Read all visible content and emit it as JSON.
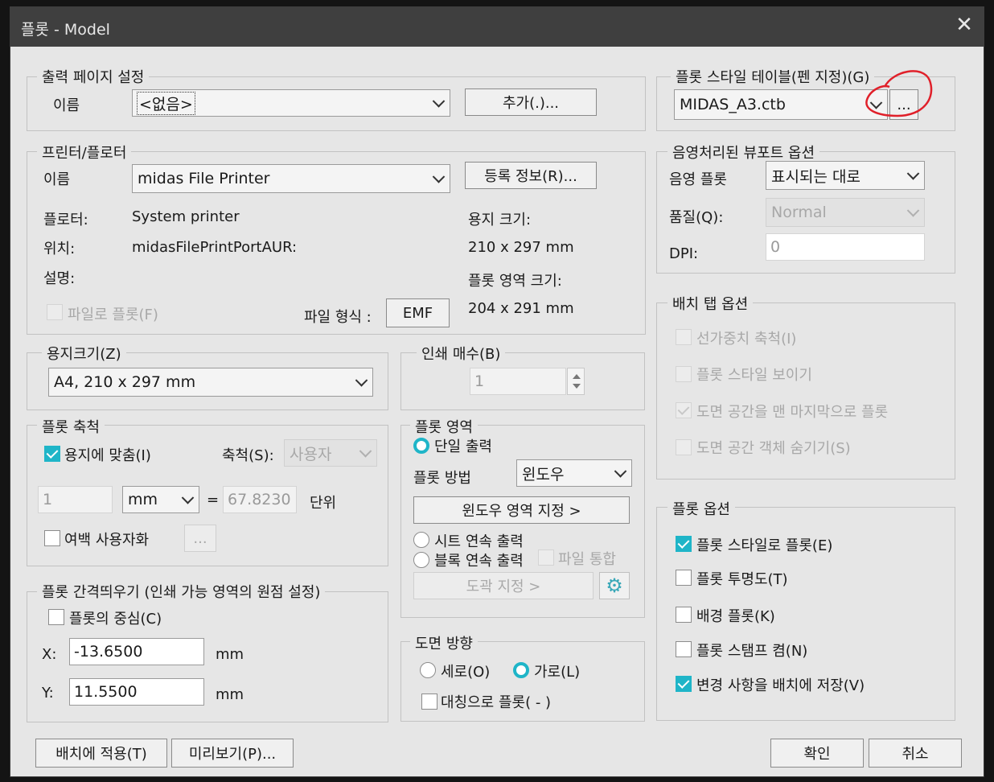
{
  "window": {
    "title": "플롯 - Model",
    "close_glyph": "✕"
  },
  "page_setup": {
    "legend": "출력 페이지 설정",
    "name_label": "이름",
    "name_value": "<없음>",
    "add_button": "추가(.)..."
  },
  "printer": {
    "legend": "프린터/플로터",
    "name_label": "이름",
    "name_value": "midas File Printer",
    "properties_button": "등록 정보(R)...",
    "plotter_label": "플로터:",
    "plotter_value": "System printer",
    "where_label": "위치:",
    "where_value": "midasFilePrintPortAUR:",
    "desc_label": "설명:",
    "plot_to_file": "파일로 플롯(F)",
    "file_format_label": "파일 형식 :",
    "file_format_button": "EMF",
    "paper_size_label": "용지 크기:",
    "paper_size_value": "210 x 297 mm",
    "plot_area_size_label": "플롯 영역 크기:",
    "plot_area_size_value": "204 x 291 mm"
  },
  "paper_size": {
    "legend": "용지크기(Z)",
    "value": "A4, 210 x 297 mm"
  },
  "copies": {
    "legend": "인쇄 매수(B)",
    "value": "1"
  },
  "plot_scale": {
    "legend": "플롯 축척",
    "fit_to_paper": "용지에 맞춤(I)",
    "scale_label": "축척(S):",
    "scale_value": "사용자",
    "value1": "1",
    "unit": "mm",
    "equals": "=",
    "value2": "67.8230",
    "unit_label": "단위",
    "scale_lineweights": "여백 사용자화",
    "ellipsis": "..."
  },
  "plot_offset": {
    "legend": "플롯 간격띄우기 (인쇄 가능 영역의 원점 설정)",
    "center": "플롯의 중심(C)",
    "x_label": "X:",
    "x_value": "-13.6500",
    "x_unit": "mm",
    "y_label": "Y:",
    "y_value": "11.5500",
    "y_unit": "mm"
  },
  "plot_area": {
    "legend": "플롯 영역",
    "single": "단일 출력",
    "method_label": "플롯 방법",
    "method_value": "윈도우",
    "window_button": "윈도우 영역 지정 >",
    "sheet_series": "시트 연속 출력",
    "block_series": "블록 연속 출력",
    "merge_file": "파일 통합",
    "frame_button": "도곽 지정 >",
    "gear_icon": "⚙"
  },
  "orientation": {
    "legend": "도면 방향",
    "portrait": "세로(O)",
    "landscape": "가로(L)",
    "upside_down": "대칭으로 플롯( - )"
  },
  "plot_style_table": {
    "legend": "플롯 스타일 테이블(펜 지정)(G)",
    "value": "MIDAS_A3.ctb",
    "edit_button": "...",
    "annotation_color": "#e0202a"
  },
  "shaded_viewport": {
    "legend": "음영처리된 뷰포트 옵션",
    "shade_label": "음영 플롯",
    "shade_value": "표시되는 대로",
    "quality_label": "품질(Q):",
    "quality_value": "Normal",
    "dpi_label": "DPI:",
    "dpi_value": "0"
  },
  "layout_options": {
    "legend": "배치 탭 옵션",
    "items": [
      "선가중치 축척(I)",
      "플롯 스타일 보이기",
      "도면 공간을 맨 마지막으로 플롯",
      "도면 공간 객체 숨기기(S)"
    ]
  },
  "plot_options": {
    "legend": "플롯 옵션",
    "items": [
      "플롯 스타일로 플롯(E)",
      "플롯 투명도(T)",
      "배경 플롯(K)",
      "플롯 스탬프 켬(N)",
      "변경 사항을 배치에 저장(V)"
    ]
  },
  "footer": {
    "apply_button": "배치에 적용(T)",
    "preview_button": "미리보기(P)...",
    "ok_button": "확인",
    "cancel_button": "취소"
  },
  "colors": {
    "accent": "#1fb5c8",
    "titlebar": "#3f3f3f",
    "dialog_bg": "#e6e6e6"
  }
}
